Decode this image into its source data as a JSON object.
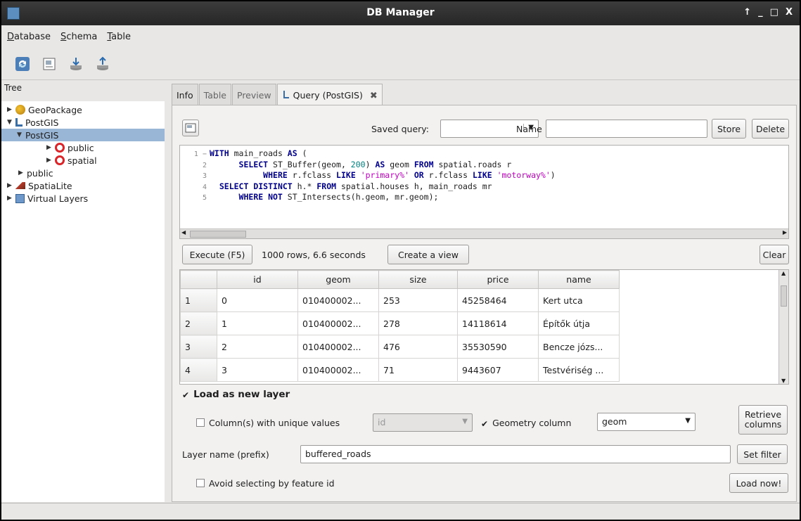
{
  "window": {
    "title": "DB Manager",
    "controls": [
      "↑",
      "_",
      "□",
      "X"
    ]
  },
  "menu": [
    "Database",
    "Schema",
    "Table"
  ],
  "tree": {
    "header": "Tree",
    "nodes": [
      {
        "label": "GeoPackage",
        "arrow": "▶"
      },
      {
        "label": "PostGIS",
        "arrow": "▼"
      },
      {
        "label": "PostGIS",
        "arrow": "▼"
      },
      {
        "label": "public",
        "arrow": "▶"
      },
      {
        "label": "spatial",
        "arrow": "▶"
      },
      {
        "label": "public",
        "arrow": "▶"
      },
      {
        "label": "SpatiaLite",
        "arrow": "▶"
      },
      {
        "label": "Virtual Layers",
        "arrow": "▶"
      }
    ]
  },
  "tabs": [
    "Info",
    "Table",
    "Preview",
    "Query (PostGIS)"
  ],
  "tab_close": "✖",
  "query": {
    "saved_query_label": "Saved query:",
    "saved_query_value": "",
    "name_label": "Name",
    "name_value": "",
    "store_label": "Store",
    "delete_label": "Delete",
    "sql_lines": [
      {
        "num": "1",
        "fold": "−"
      },
      {
        "num": "2"
      },
      {
        "num": "3"
      },
      {
        "num": "4"
      },
      {
        "num": "5"
      }
    ],
    "sql": {
      "l1_kw1": "WITH",
      "l1_t1": " main_roads ",
      "l1_kw2": "AS",
      "l1_t2": " (",
      "l2_kw1": "SELECT",
      "l2_t1": " ST_Buffer(geom, ",
      "l2_num": "200",
      "l2_t2": ") ",
      "l2_kw2": "AS",
      "l2_t3": " geom ",
      "l2_kw3": "FROM",
      "l2_t4": " spatial.roads r",
      "l3_kw1": "WHERE",
      "l3_t1": " r.fclass ",
      "l3_kw2": "LIKE",
      "l3_s1": "'primary%'",
      "l3_kw3": "OR",
      "l3_t2": " r.fclass ",
      "l3_kw4": "LIKE",
      "l3_s2": "'motorway%'",
      "l3_t3": ")",
      "l4_kw1": "SELECT DISTINCT",
      "l4_t1": " h.* ",
      "l4_kw2": "FROM",
      "l4_t2": " spatial.houses h, main_roads mr",
      "l5_kw1": "WHERE NOT",
      "l5_t1": " ST_Intersects(h.geom, mr.geom);"
    },
    "execute_label": "Execute (F5)",
    "result_info": "1000 rows, 6.6 seconds",
    "create_view_label": "Create a view",
    "clear_label": "Clear"
  },
  "results": {
    "columns": [
      "id",
      "geom",
      "size",
      "price",
      "name"
    ],
    "rows": [
      {
        "rh": "1",
        "cells": [
          "0",
          "010400002...",
          "253",
          "45258464",
          "Kert utca"
        ]
      },
      {
        "rh": "2",
        "cells": [
          "1",
          "010400002...",
          "278",
          "14118614",
          "Építők útja"
        ]
      },
      {
        "rh": "3",
        "cells": [
          "2",
          "010400002...",
          "476",
          "35530590",
          "Bencze józs..."
        ]
      },
      {
        "rh": "4",
        "cells": [
          "3",
          "010400002...",
          "71",
          "9443607",
          "Testvériség ..."
        ]
      }
    ]
  },
  "load": {
    "load_as_new_layer": "Load as new layer",
    "unique_cols_label": "Column(s) with unique values",
    "unique_cols_value": "id",
    "geometry_col_label": "Geometry column",
    "geometry_col_value": "geom",
    "retrieve_line1": "Retrieve",
    "retrieve_line2": "columns",
    "layer_name_label": "Layer name (prefix)",
    "layer_name_value": "buffered_roads",
    "set_filter_label": "Set filter",
    "avoid_label": "Avoid selecting by feature id",
    "load_now_label": "Load now!",
    "checked_mark": "✔"
  },
  "colors": {
    "selection": "#9ab6d6",
    "keyword": "#00008b",
    "string": "#c000c0",
    "number": "#008080"
  }
}
